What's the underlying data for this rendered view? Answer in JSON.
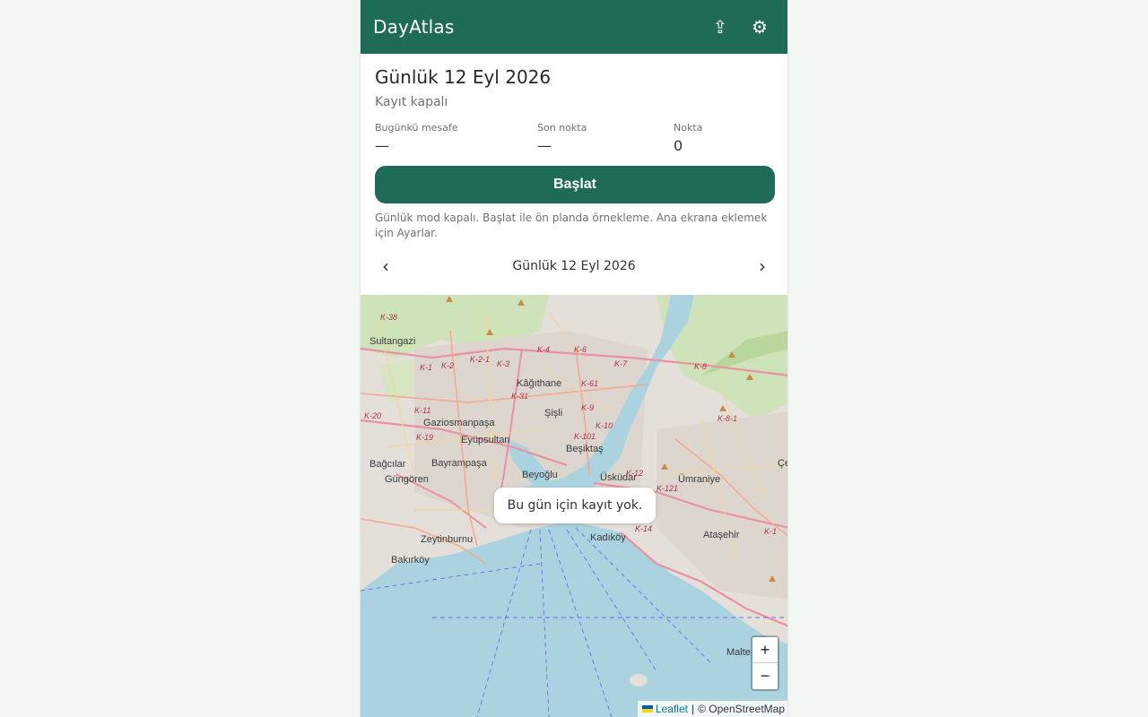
{
  "app": {
    "title": "DayAtlas",
    "share_icon": "share-icon",
    "settings_icon": "gear-icon"
  },
  "day": {
    "title": "Günlük 12 Eyl 2026",
    "recording_status": "Kayıt kapalı"
  },
  "stats": [
    {
      "label": "Bugünkü mesafe",
      "value": "—"
    },
    {
      "label": "Son nokta",
      "value": "—"
    },
    {
      "label": "Nokta",
      "value": "0"
    }
  ],
  "start_button": "Başlat",
  "hint": "Günlük mod kapalı. Başlat ile ön planda örnekleme. Ana ekrana eklemek için Ayarlar.",
  "day_nav": {
    "prev": "‹",
    "label": "Günlük 12 Eyl 2026",
    "next": "›"
  },
  "map": {
    "empty_message": "Bu gün için kayıt yok.",
    "zoom_in": "+",
    "zoom_out": "−",
    "attribution_link": "Leaflet",
    "attribution_separator": "|",
    "attribution_text": "© OpenStreetMap",
    "places": [
      "Sultangazi",
      "Kâğıthane",
      "Şişli",
      "Gaziosmanpaşa",
      "Eyüpsultan",
      "Beşiktaş",
      "Bağcılar",
      "Bayrampaşa",
      "Güngören",
      "Beyoğlu",
      "Üsküdar",
      "Ümraniye",
      "Zeytinburnu",
      "Kadıköy",
      "Ataşehir",
      "Bakırköy",
      "Malte",
      "Çe",
      "Malte"
    ],
    "road_tags": [
      "K-38",
      "K-4",
      "K-6",
      "K-2-1",
      "K-3",
      "K-2",
      "K-1",
      "K-7",
      "K-8",
      "K-61",
      "K-31",
      "K-9",
      "K-20",
      "K-11",
      "K-10",
      "K-101",
      "K-19",
      "K-12",
      "K-121",
      "K-14",
      "K-8-1",
      "K-1"
    ],
    "colors": {
      "water": "#aad3df",
      "land": "#ede8df",
      "urban": "#e0dcd5",
      "green": "#c8dfb0",
      "motorway": "#e892a2",
      "trunk": "#f9b29c",
      "road": "#f7d9a0"
    }
  }
}
